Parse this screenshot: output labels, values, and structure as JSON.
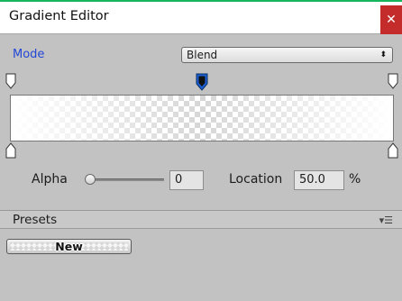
{
  "window": {
    "title": "Gradient Editor",
    "close_glyph": "✕"
  },
  "mode": {
    "label": "Mode",
    "selected": "Blend",
    "arrow_glyph": "⬍"
  },
  "gradient": {
    "alpha_keys": [
      {
        "location": 0,
        "alpha": 255
      },
      {
        "location": 50,
        "alpha": 0,
        "selected": true
      },
      {
        "location": 100,
        "alpha": 255
      }
    ],
    "color_keys": [
      {
        "location": 0,
        "color": "#ffffff"
      },
      {
        "location": 100,
        "color": "#ffffff"
      }
    ]
  },
  "alpha_row": {
    "alpha_label": "Alpha",
    "alpha_value": "0",
    "location_label": "Location",
    "location_value": "50.0",
    "percent_sign": "%"
  },
  "presets": {
    "label": "Presets",
    "menu_glyph": "▾☰",
    "new_button_label": "New"
  },
  "colors": {
    "accent_blue": "#2147d6",
    "close_red": "#c42b2b",
    "panel_bg": "#c2c2c2",
    "selected_marker": "#1c5fd1"
  }
}
